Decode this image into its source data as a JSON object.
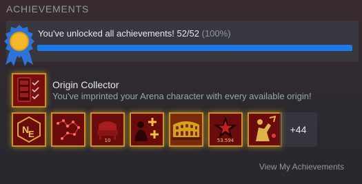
{
  "header": {
    "title": "ACHIEVEMENTS"
  },
  "progress": {
    "message": "You've unlocked all achievements! 52/52",
    "percent_label": "(100%)",
    "fraction": 1.0
  },
  "featured": {
    "title": "Origin Collector",
    "description": "You've imprinted your Arena character with every available origin!",
    "icon": "origin-collector-icon"
  },
  "icons": [
    {
      "name": "ne-monogram-icon",
      "label": ""
    },
    {
      "name": "constellation-icon",
      "label": ""
    },
    {
      "name": "armchair-icon",
      "label": "10"
    },
    {
      "name": "silhouette-plus-icon",
      "label": ""
    },
    {
      "name": "colosseum-icon",
      "label": ""
    },
    {
      "name": "star-badge-icon",
      "label": "53.594"
    },
    {
      "name": "warrior-icon",
      "label": ""
    }
  ],
  "more": {
    "label": "+44"
  },
  "footer": {
    "link_label": "View My Achievements"
  },
  "colors": {
    "accent_blue": "#1a7ae8",
    "gold_border": "#c9941c",
    "icon_red": "#5e0a0a",
    "badge_blue": "#2e73d8",
    "badge_gold": "#f2b92b"
  }
}
